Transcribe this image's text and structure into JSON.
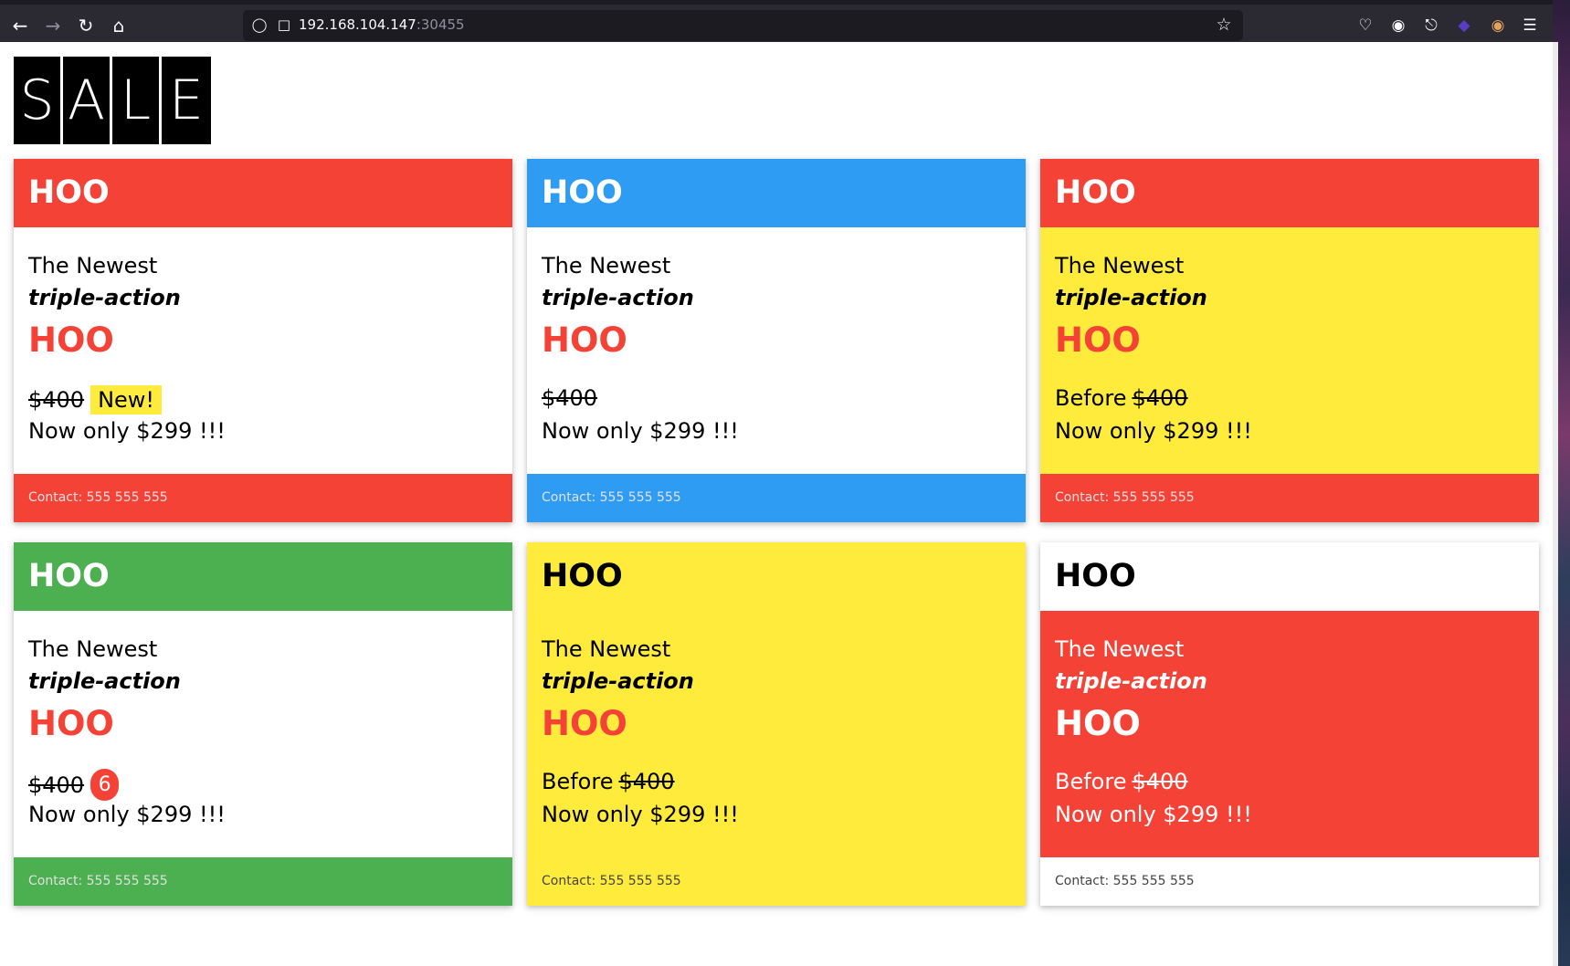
{
  "browser": {
    "url_host": "192.168.104.147",
    "url_port": ":30455",
    "icons": {
      "back": "arrow-left-icon",
      "forward": "arrow-right-icon",
      "reload": "reload-icon",
      "home": "home-icon",
      "shield": "shield-icon",
      "lock": "lock-icon",
      "bookmark": "star-icon",
      "pocket": "pocket-icon",
      "account": "account-icon",
      "extensions": "puzzle-icon",
      "extension_a": "extension-icon",
      "extension_b": "extension-badge-icon",
      "menu": "hamburger-menu-icon"
    }
  },
  "logo": {
    "letters": [
      "S",
      "A",
      "L",
      "E"
    ]
  },
  "colors": {
    "red": "#f44336",
    "blue": "#2f9cf4",
    "green": "#4caf50",
    "yellow": "#ffeb3b",
    "white": "#ffffff"
  },
  "cards": [
    {
      "header": "HOO",
      "newest": "The Newest",
      "triple": "triple-action",
      "product": "HOO",
      "before": "",
      "old_price": "$400",
      "tag": "New!",
      "now": "Now only $299 !!!",
      "contact": "Contact: 555 555 555"
    },
    {
      "header": "HOO",
      "newest": "The Newest",
      "triple": "triple-action",
      "product": "HOO",
      "before": "",
      "old_price": "$400",
      "tag": "",
      "now": "Now only $299 !!!",
      "contact": "Contact: 555 555 555"
    },
    {
      "header": "HOO",
      "newest": "The Newest",
      "triple": "triple-action",
      "product": "HOO",
      "before": "Before",
      "old_price": "$400",
      "tag": "",
      "now": "Now only $299 !!!",
      "contact": "Contact: 555 555 555"
    },
    {
      "header": "HOO",
      "newest": "The Newest",
      "triple": "triple-action",
      "product": "HOO",
      "before": "",
      "old_price": "$400",
      "badge": "6",
      "now": "Now only $299 !!!",
      "contact": "Contact: 555 555 555"
    },
    {
      "header": "HOO",
      "newest": "The Newest",
      "triple": "triple-action",
      "product": "HOO",
      "before": "Before",
      "old_price": "$400",
      "tag": "",
      "now": "Now only $299 !!!",
      "contact": "Contact: 555 555 555"
    },
    {
      "header": "HOO",
      "newest": "The Newest",
      "triple": "triple-action",
      "product": "HOO",
      "before": "Before",
      "old_price": "$400",
      "tag": "",
      "now": "Now only $299 !!!",
      "contact": "Contact: 555 555 555"
    }
  ]
}
